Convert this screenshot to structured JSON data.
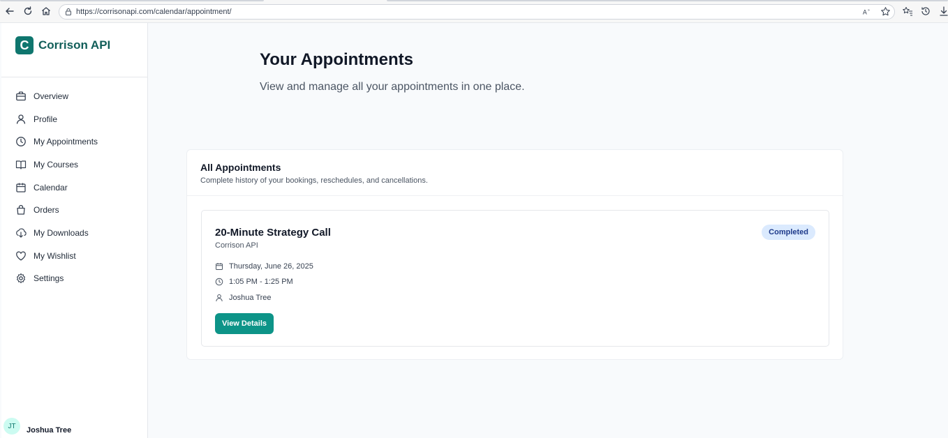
{
  "browser": {
    "url": "https://corrisonapi.com/calendar/appointment/"
  },
  "sidebar": {
    "logo_letter": "C",
    "logo_text": "Corrison API",
    "items": [
      {
        "label": "Overview",
        "icon": "briefcase-icon"
      },
      {
        "label": "Profile",
        "icon": "user-icon"
      },
      {
        "label": "My Appointments",
        "icon": "clock-icon"
      },
      {
        "label": "My Courses",
        "icon": "book-icon"
      },
      {
        "label": "Calendar",
        "icon": "calendar-icon"
      },
      {
        "label": "Orders",
        "icon": "shopping-bag-icon"
      },
      {
        "label": "My Downloads",
        "icon": "cloud-download-icon"
      },
      {
        "label": "My Wishlist",
        "icon": "heart-icon"
      },
      {
        "label": "Settings",
        "icon": "gear-icon"
      }
    ],
    "user": {
      "initials": "JT",
      "name": "Joshua Tree"
    }
  },
  "main": {
    "title": "Your Appointments",
    "subtitle": "View and manage all your appointments in one place.",
    "card": {
      "title": "All Appointments",
      "subtitle": "Complete history of your bookings, reschedules, and cancellations.",
      "appointments": [
        {
          "title": "20-Minute Strategy Call",
          "org": "Corrison API",
          "status": "Completed",
          "date": "Thursday, June 26, 2025",
          "time": "1:05 PM - 1:25 PM",
          "person": "Joshua Tree",
          "button": "View Details"
        }
      ]
    }
  },
  "colors": {
    "brand": "#0f766e",
    "button": "#0d9488",
    "badge_bg": "#dbeafe",
    "badge_text": "#1e3a8a"
  }
}
